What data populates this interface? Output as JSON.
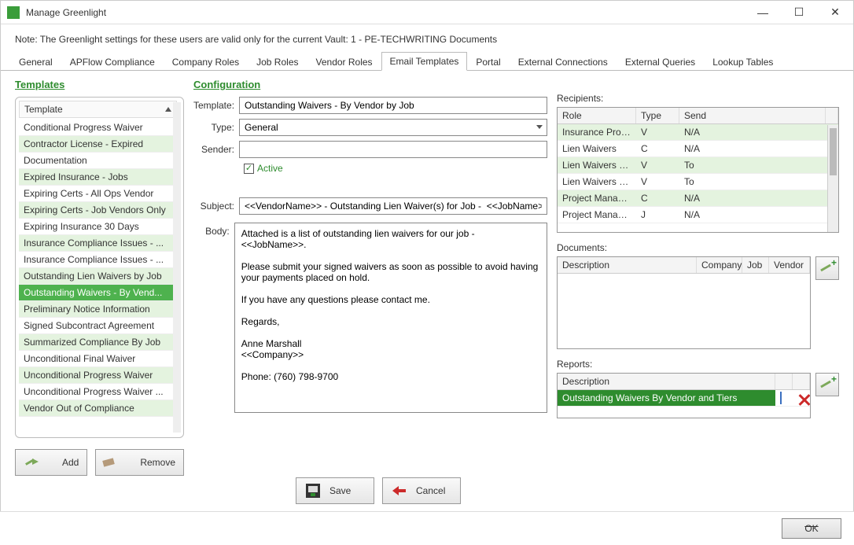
{
  "window": {
    "title": "Manage Greenlight",
    "note": "Note:  The Greenlight settings for these users are valid only for the current Vault: 1 - PE-TECHWRITING Documents"
  },
  "tabs": [
    "General",
    "APFlow Compliance",
    "Company Roles",
    "Job Roles",
    "Vendor Roles",
    "Email Templates",
    "Portal",
    "External Connections",
    "External Queries",
    "Lookup Tables"
  ],
  "active_tab": "Email Templates",
  "left": {
    "title": "Templates",
    "header": "Template",
    "items": [
      {
        "label": "Conditional Progress Waiver",
        "alt": false
      },
      {
        "label": "Contractor License - Expired",
        "alt": true
      },
      {
        "label": "Documentation",
        "alt": false
      },
      {
        "label": "Expired Insurance - Jobs",
        "alt": true
      },
      {
        "label": "Expiring Certs - All Ops Vendor",
        "alt": false
      },
      {
        "label": "Expiring Certs - Job Vendors Only",
        "alt": true
      },
      {
        "label": "Expiring Insurance 30 Days",
        "alt": false
      },
      {
        "label": "Insurance Compliance Issues - ...",
        "alt": true
      },
      {
        "label": "Insurance Compliance Issues - ...",
        "alt": false
      },
      {
        "label": "Outstanding Lien Waivers by Job",
        "alt": true
      },
      {
        "label": "Outstanding Waivers - By Vend...",
        "alt": false,
        "selected": true
      },
      {
        "label": "Preliminary Notice Information",
        "alt": true
      },
      {
        "label": "Signed Subcontract Agreement",
        "alt": false
      },
      {
        "label": "Summarized Compliance By Job",
        "alt": true
      },
      {
        "label": "Unconditional Final Waiver",
        "alt": false
      },
      {
        "label": "Unconditional Progress Waiver",
        "alt": true
      },
      {
        "label": "Unconditional Progress Waiver ...",
        "alt": false
      },
      {
        "label": "Vendor Out of Compliance",
        "alt": true
      }
    ],
    "add": "Add",
    "remove": "Remove"
  },
  "mid": {
    "title": "Configuration",
    "labels": {
      "template": "Template:",
      "type": "Type:",
      "sender": "Sender:",
      "active": "Active",
      "subject": "Subject:",
      "body": "Body:"
    },
    "template": "Outstanding Waivers - By Vendor by Job",
    "type": "General",
    "sender": "",
    "active": true,
    "subject": "<<VendorName>> - Outstanding Lien Waiver(s) for Job -  <<JobName>>",
    "body": "Attached is a list of outstanding lien waivers for our job - <<JobName>>.\n\nPlease submit your signed waivers as soon as possible to avoid having your payments placed on hold.\n\nIf you have any questions please contact me.\n\nRegards,\n\nAnne Marshall\n<<Company>>\n\nPhone: (760) 798-9700"
  },
  "right": {
    "recipients_label": "Recipients:",
    "recipients_cols": {
      "role": "Role",
      "type": "Type",
      "send": "Send"
    },
    "recipients": [
      {
        "role": "Insurance Proces...",
        "type": "V",
        "send": "N/A",
        "alt": true
      },
      {
        "role": "Lien Waivers",
        "type": "C",
        "send": "N/A",
        "alt": false
      },
      {
        "role": "Lien Waivers - Pri...",
        "type": "V",
        "send": "To",
        "alt": true
      },
      {
        "role": "Lien Waivers - Tier",
        "type": "V",
        "send": "To",
        "alt": false
      },
      {
        "role": "Project Manager",
        "type": "C",
        "send": "N/A",
        "alt": true
      },
      {
        "role": "Project Manager",
        "type": "J",
        "send": "N/A",
        "alt": false
      }
    ],
    "documents_label": "Documents:",
    "documents_cols": {
      "desc": "Description",
      "company": "Company",
      "job": "Job",
      "vendor": "Vendor"
    },
    "reports_label": "Reports:",
    "reports_cols": {
      "desc": "Description"
    },
    "reports": [
      {
        "desc": "Outstanding Waivers By Vendor and Tiers"
      }
    ]
  },
  "bottom": {
    "save": "Save",
    "cancel": "Cancel",
    "ok": "OK"
  }
}
